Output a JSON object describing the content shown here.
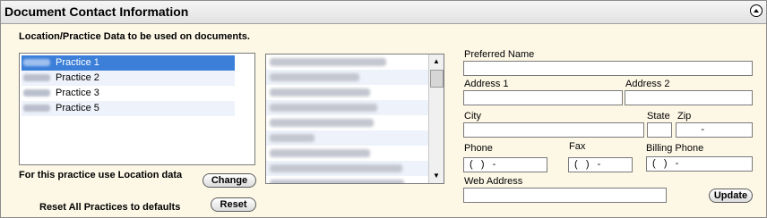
{
  "header": {
    "title": "Document Contact Information"
  },
  "section_label": "Location/Practice Data to be used on documents.",
  "practices": [
    {
      "label": "Practice 1",
      "selected": true
    },
    {
      "label": "Practice 2"
    },
    {
      "label": "Practice 3"
    },
    {
      "label": "Practice 5"
    }
  ],
  "locations_count": 9,
  "practice_use_label": "For this practice use Location data",
  "change_button": "Change",
  "reset_label": "Reset All Practices to defaults",
  "reset_button": "Reset",
  "form": {
    "preferred_name": {
      "label": "Preferred Name",
      "value": ""
    },
    "address1": {
      "label": "Address 1",
      "value": ""
    },
    "address2": {
      "label": "Address 2",
      "value": ""
    },
    "city": {
      "label": "City",
      "value": ""
    },
    "state": {
      "label": "State",
      "value": ""
    },
    "zip": {
      "label": "Zip",
      "value": "       -"
    },
    "phone": {
      "label": "Phone",
      "value": "(   )   -"
    },
    "fax": {
      "label": "Fax",
      "value": "(   )   -"
    },
    "billing_phone": {
      "label": "Billing Phone",
      "value": "(   )   -"
    },
    "web_address": {
      "label": "Web Address",
      "value": ""
    }
  },
  "update_button": "Update"
}
